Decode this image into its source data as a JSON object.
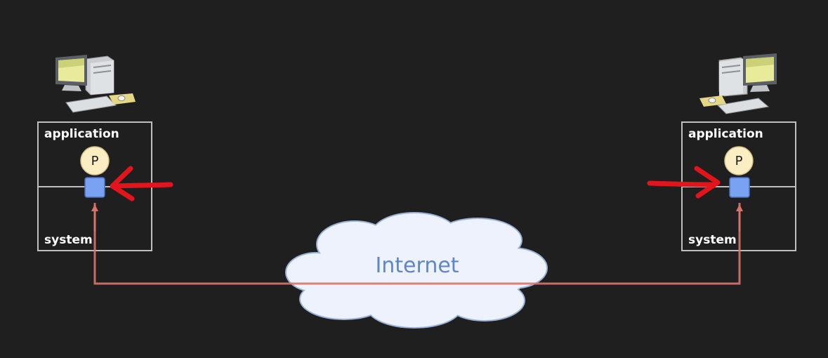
{
  "diagram": {
    "left_host": {
      "application_label": "application",
      "system_label": "system",
      "process_label": "P"
    },
    "right_host": {
      "application_label": "application",
      "system_label": "system",
      "process_label": "P"
    },
    "network": {
      "label": "Internet"
    }
  },
  "colors": {
    "background": "#201f20",
    "socket": "#79a2f2",
    "process": "#fbeec2",
    "connection": "#d9736a",
    "annotation": "#e2141c",
    "cloud_fill": "#eef2fc",
    "cloud_stroke": "#9bb3d8"
  }
}
